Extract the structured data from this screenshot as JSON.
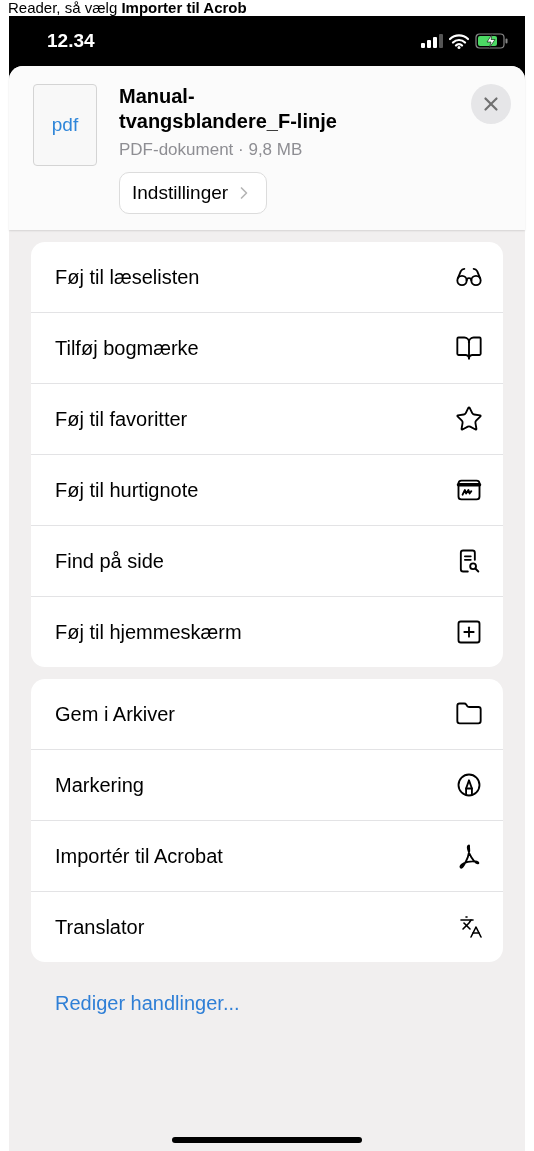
{
  "caption": "Reader, så vælg **Importer til Acrob**",
  "status_bar": {
    "time": "12.34"
  },
  "file": {
    "type_label": "pdf",
    "name": "Manual-\ntvangsblandere_F-linje",
    "details": "PDF-dokument · 9,8 MB",
    "options_button": "Indstillinger"
  },
  "action_groups": [
    {
      "items": [
        "Føj til læselisten",
        "Tilføj bogmærke",
        "Føj til favoritter",
        "Føj til hurtignote",
        "Find på side",
        "Føj til hjemmeskærm"
      ]
    },
    {
      "items": [
        "Gem i Arkiver",
        "Markering",
        "Importér til Acrobat",
        "Translator"
      ]
    }
  ],
  "edit_actions_link": "Rediger handlinger..."
}
